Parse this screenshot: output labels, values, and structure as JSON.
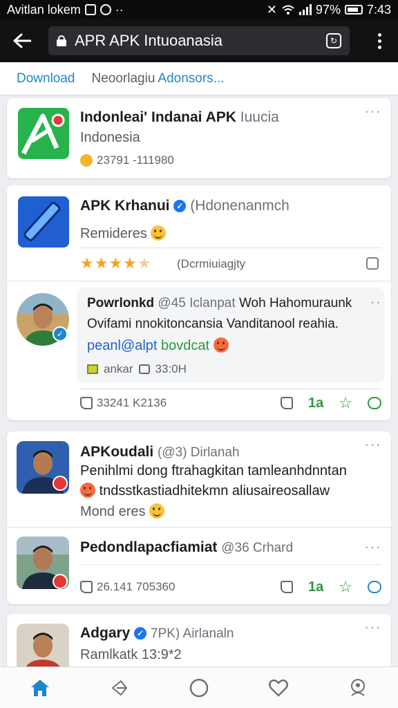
{
  "status_bar": {
    "carrier": "Avitlan lokem",
    "time": "7:43",
    "battery": "97%"
  },
  "browser": {
    "url": "APR APK Intuoanasia"
  },
  "tabs": {
    "download": "Download",
    "second": "Neoorlagiu",
    "third": "Adonsors..."
  },
  "cards": [
    {
      "title": "Indonleai' Indanai APK",
      "title_sub": "Iuucia",
      "subtitle": "Indonesia",
      "meta": "23791 -111980"
    },
    {
      "title": "APK Krhanui",
      "title_sub": "(Hdonenanmch",
      "line": "Remideres",
      "rating_text": "(Dcrmiuiagjty",
      "stars_full": 4,
      "post": {
        "author": "Powrlonkd",
        "handle": "@45 Iclanpat",
        "rest": "Woh Hahomuraunk",
        "line2": "Ovifami nnokitoncansia Vanditanool reahia.",
        "tag_blue": "peanl@alpt",
        "tag_green": "bovdcat",
        "meta_a": "ankar",
        "meta_b": "33:0H"
      },
      "count": "33241 K2136",
      "likes": "1a"
    },
    {
      "title": "APKoudali",
      "handle": "(@3) Dirlanah",
      "line1": "Penihlmi dong ftrahagkitan tamleanhdnntan",
      "line2": "tndsstkastiadhitekmn aliusaireosallaw",
      "line3": "Mond eres"
    },
    {
      "title": "Pedondlapacfiamiat",
      "handle": "@36 Crhard",
      "count": "26.141 705360",
      "likes": "1a"
    },
    {
      "title": "Adgary",
      "handle": "7PK) Airlanaln",
      "line": "Ramlkatk 13:9*2"
    }
  ],
  "colors": {
    "accent": "#1f86c9",
    "green": "#2b9a3a",
    "star": "#f4a423"
  }
}
